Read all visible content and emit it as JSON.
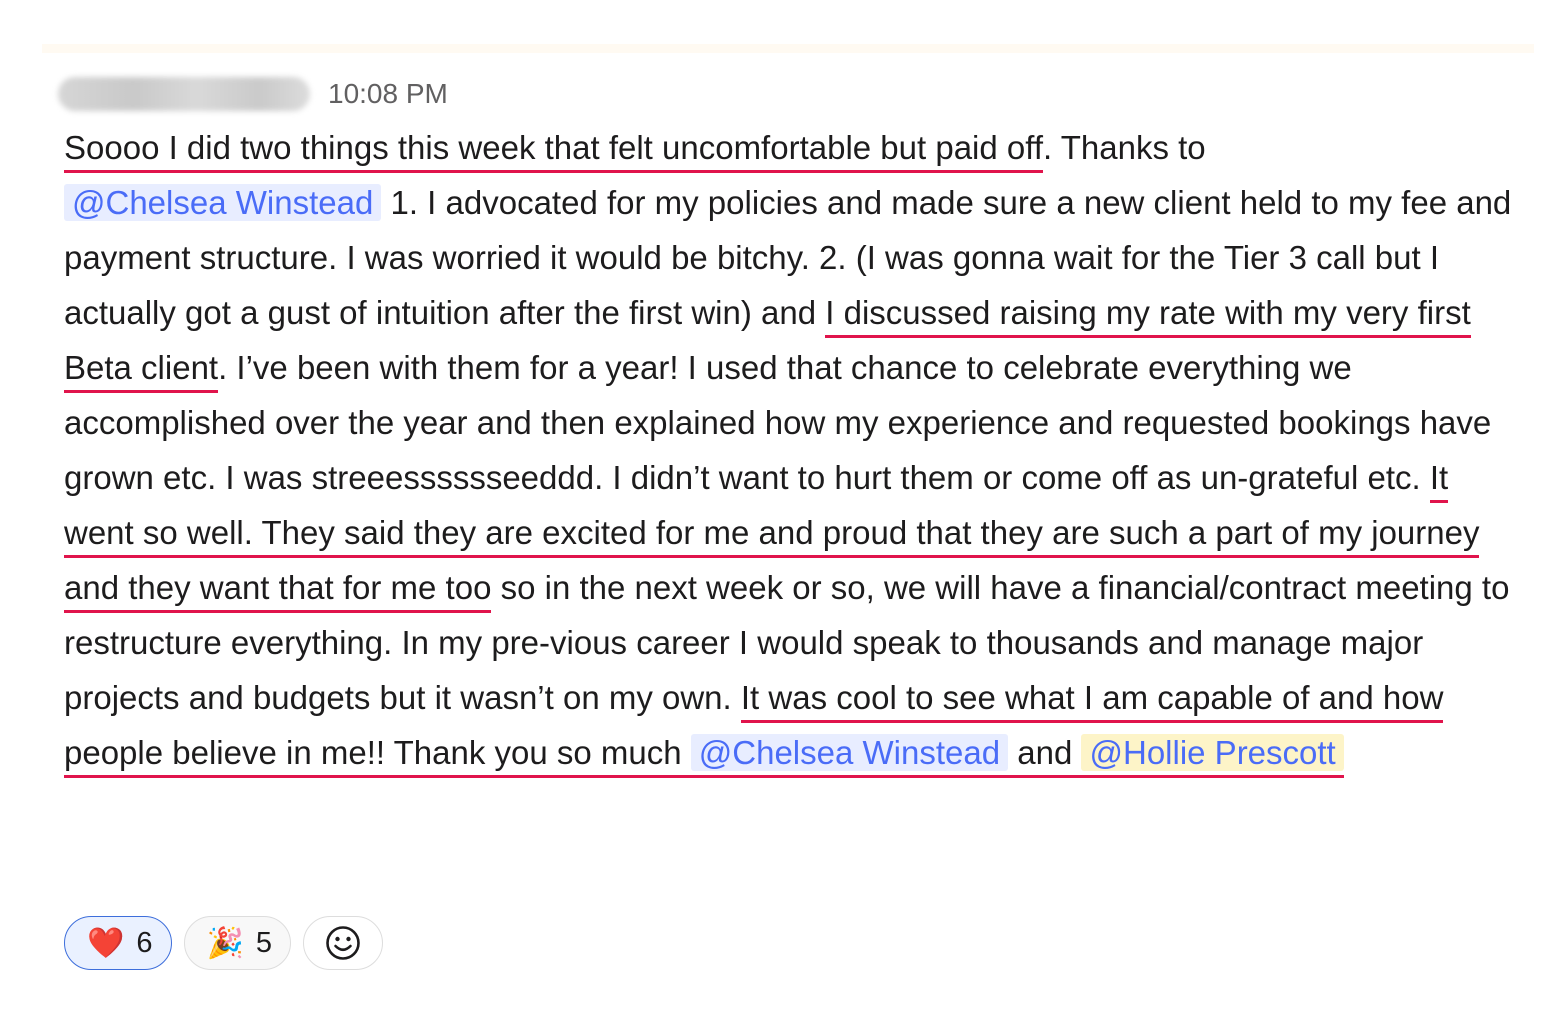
{
  "message": {
    "timestamp": "10:08 PM",
    "segments": {
      "s01": "Soooo I did two things this week that felt uncomfortable but paid off",
      "s02": ". Thanks to",
      "s03": "@Chelsea Winstead",
      "s04": "1. I advocated for my policies and made sure a new client held to my fee and payment structure. I was worried it would be bitchy. 2. (I was gonna wait for the Tier 3 call but I actually got a gust of intuition after the first win) and ",
      "s05": "I discussed raising my rate with my very first Beta client",
      "s06": ". I’ve been with them for a year! I used that chance to celebrate everything we accomplished over the year and then explained how my experience and requested bookings have grown etc. I was streeesssssseeddd. I didn’t want to hurt them or come off as un-grateful etc. ",
      "s07": "It went so well. They said they are excited for me and proud that they are such a part of my journey and they want that for me too",
      "s08": " so in the next week or so, we will have a financial/contract meeting to restructure everything. In my pre-vious career I would speak to thousands and manage major projects and budgets but it wasn’t on my own. ",
      "s09": "It was cool to see what I am capable of and how people believe in me!! Thank you so much",
      "s10": "@Chelsea Winstead",
      "s11": "and",
      "s12": "@Hollie Prescott"
    }
  },
  "reactions": [
    {
      "emoji": "❤️",
      "count": "6",
      "icon": "red-heart-icon",
      "active": true
    },
    {
      "emoji": "🎉",
      "count": "5",
      "icon": "party-popper-icon",
      "active": false
    }
  ],
  "add_reaction_icon": "smiley-add-reaction-icon",
  "colors": {
    "underline": "#e0144c",
    "mention_text": "#4a6cf7",
    "mention_bg": "#e8edff",
    "mention_highlight_bg": "#fdf4c8",
    "active_reaction_border": "#3d6edb"
  }
}
